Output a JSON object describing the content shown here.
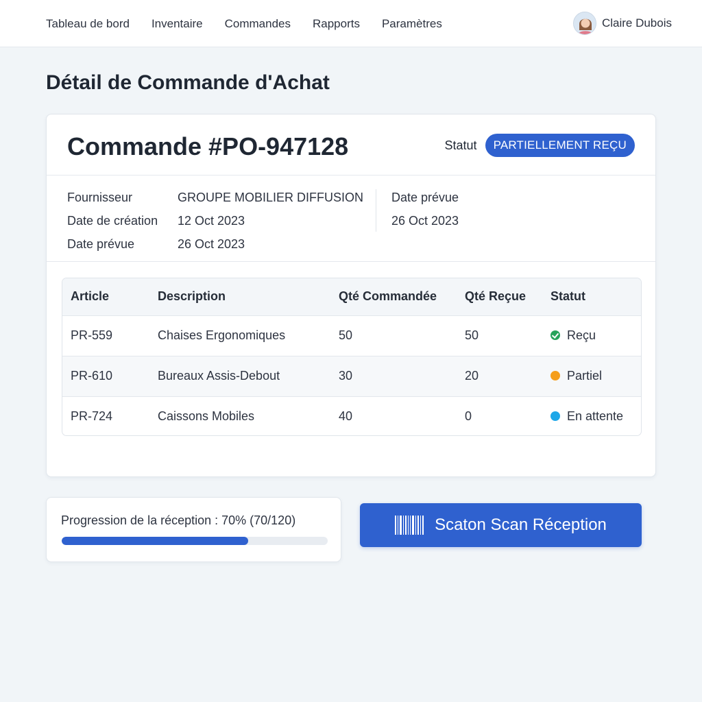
{
  "nav": {
    "items": [
      "Tableau de bord",
      "Inventaire",
      "Commandes",
      "Rapports",
      "Paramètres"
    ],
    "user_name": "Claire Dubois"
  },
  "page": {
    "title": "Détail de Commande d'Achat"
  },
  "order": {
    "id": "Commande #PO-947128",
    "status_label": "Statut",
    "status_value": "PARTIELLEMENT REÇU",
    "meta": [
      {
        "label": "Fournisseur",
        "value": "GROUPE MOBILIER DIFFUSION"
      },
      {
        "label": "Date de création",
        "value": "12 Oct 2023"
      },
      {
        "label": "Date prévue",
        "value": "26 Oct 2023"
      }
    ],
    "meta_right": {
      "label": "Date prévue",
      "value": "26 Oct 2023"
    }
  },
  "table": {
    "headers": [
      "Article",
      "Description",
      "Qté Commandée",
      "Qté Reçue",
      "Statut"
    ],
    "rows": [
      {
        "article": "PR-559",
        "description": "Chaises Ergonomiques",
        "ordered": "50",
        "received": "50",
        "status": "Reçu",
        "status_color": "#27a35b",
        "status_icon": "check-icon"
      },
      {
        "article": "PR-610",
        "description": "Bureaux Assis-Debout",
        "ordered": "30",
        "received": "20",
        "status": "Partiel",
        "status_color": "#f59e1b",
        "status_icon": "dot"
      },
      {
        "article": "PR-724",
        "description": "Caissons Mobiles",
        "ordered": "40",
        "received": "0",
        "status": "En attente",
        "status_color": "#1ea7e8",
        "status_icon": "dot"
      }
    ]
  },
  "progress": {
    "text": "Progression de la réception : 70% (70/120)",
    "percent": 70
  },
  "scan_button": {
    "label": "Scaton Scan Réception",
    "icon": "barcode-icon"
  },
  "colors": {
    "accent": "#2f61cf",
    "background": "#f1f5f8"
  }
}
